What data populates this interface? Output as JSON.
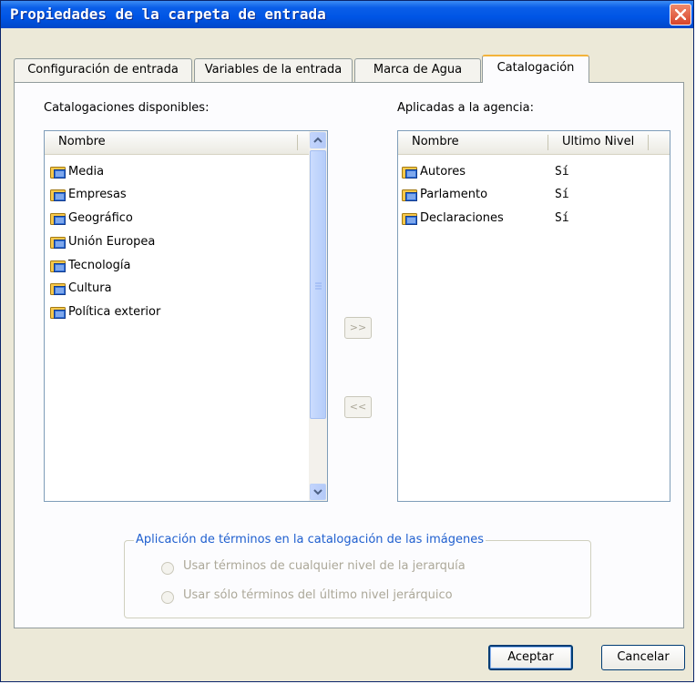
{
  "window": {
    "title": "Propiedades de la carpeta de entrada"
  },
  "tabs": [
    {
      "label": "Configuración de entrada",
      "active": false
    },
    {
      "label": "Variables de la entrada",
      "active": false
    },
    {
      "label": "Marca de Agua",
      "active": false
    },
    {
      "label": "Catalogación",
      "active": true
    }
  ],
  "available": {
    "label": "Catalogaciones disponibles:",
    "column": "Nombre",
    "items": [
      "Media",
      "Empresas",
      "Geográfico",
      "Unión Europea",
      "Tecnología",
      "Cultura",
      "Política exterior"
    ]
  },
  "applied": {
    "label": "Aplicadas a la agencia:",
    "columns": [
      "Nombre",
      "Ultimo Nivel"
    ],
    "rows": [
      {
        "name": "Autores",
        "last_level": "Sí"
      },
      {
        "name": "Parlamento",
        "last_level": "Sí"
      },
      {
        "name": "Declaraciones",
        "last_level": "Sí"
      }
    ]
  },
  "transfer": {
    "add": ">>",
    "remove": "<<"
  },
  "terms": {
    "legend": "Aplicación de términos en la catalogación de las imágenes",
    "options": [
      "Usar términos de cualquier nivel de la jerarquía",
      "Usar sólo términos del último nivel jerárquico"
    ],
    "enabled": false
  },
  "buttons": {
    "ok": "Aceptar",
    "cancel": "Cancelar"
  },
  "colors": {
    "titlebar": "#0055e5",
    "close": "#d7442a",
    "legend": "#1f5fcf",
    "disabled_text": "#aca899"
  },
  "icons": {
    "folder": "catalog-folder-icon",
    "close": "close-icon"
  }
}
